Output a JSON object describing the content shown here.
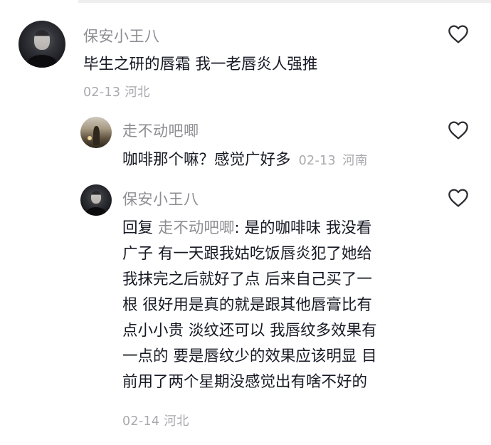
{
  "comments": [
    {
      "username": "保安小王八",
      "text": "毕生之研的唇霜 我一老唇炎人强推",
      "date": "02-13",
      "location": "河北",
      "like_icon": "heart-outline-icon"
    },
    {
      "username": "走不动吧唧",
      "text": "咖啡那个嘛？感觉广好多",
      "date": "02-13",
      "location": "河南",
      "like_icon": "heart-outline-icon"
    },
    {
      "username": "保安小王八",
      "reply_prefix": "回复",
      "reply_to": "走不动吧唧",
      "text_lines": [
        ": 是的咖啡味 我没看",
        "广子 有一天跟我姑吃饭唇炎犯了她给",
        "我抹完之后就好了点 后来自己买了一",
        "根 很好用是真的就是跟其他唇膏比有",
        "点小小贵 淡纹还可以 我唇纹多效果有",
        "一点的 要是唇纹少的效果应该明显 目",
        "前用了两个星期没感觉出有啥不好的"
      ],
      "date": "02-14",
      "location": "河北",
      "like_icon": "heart-outline-icon"
    }
  ]
}
